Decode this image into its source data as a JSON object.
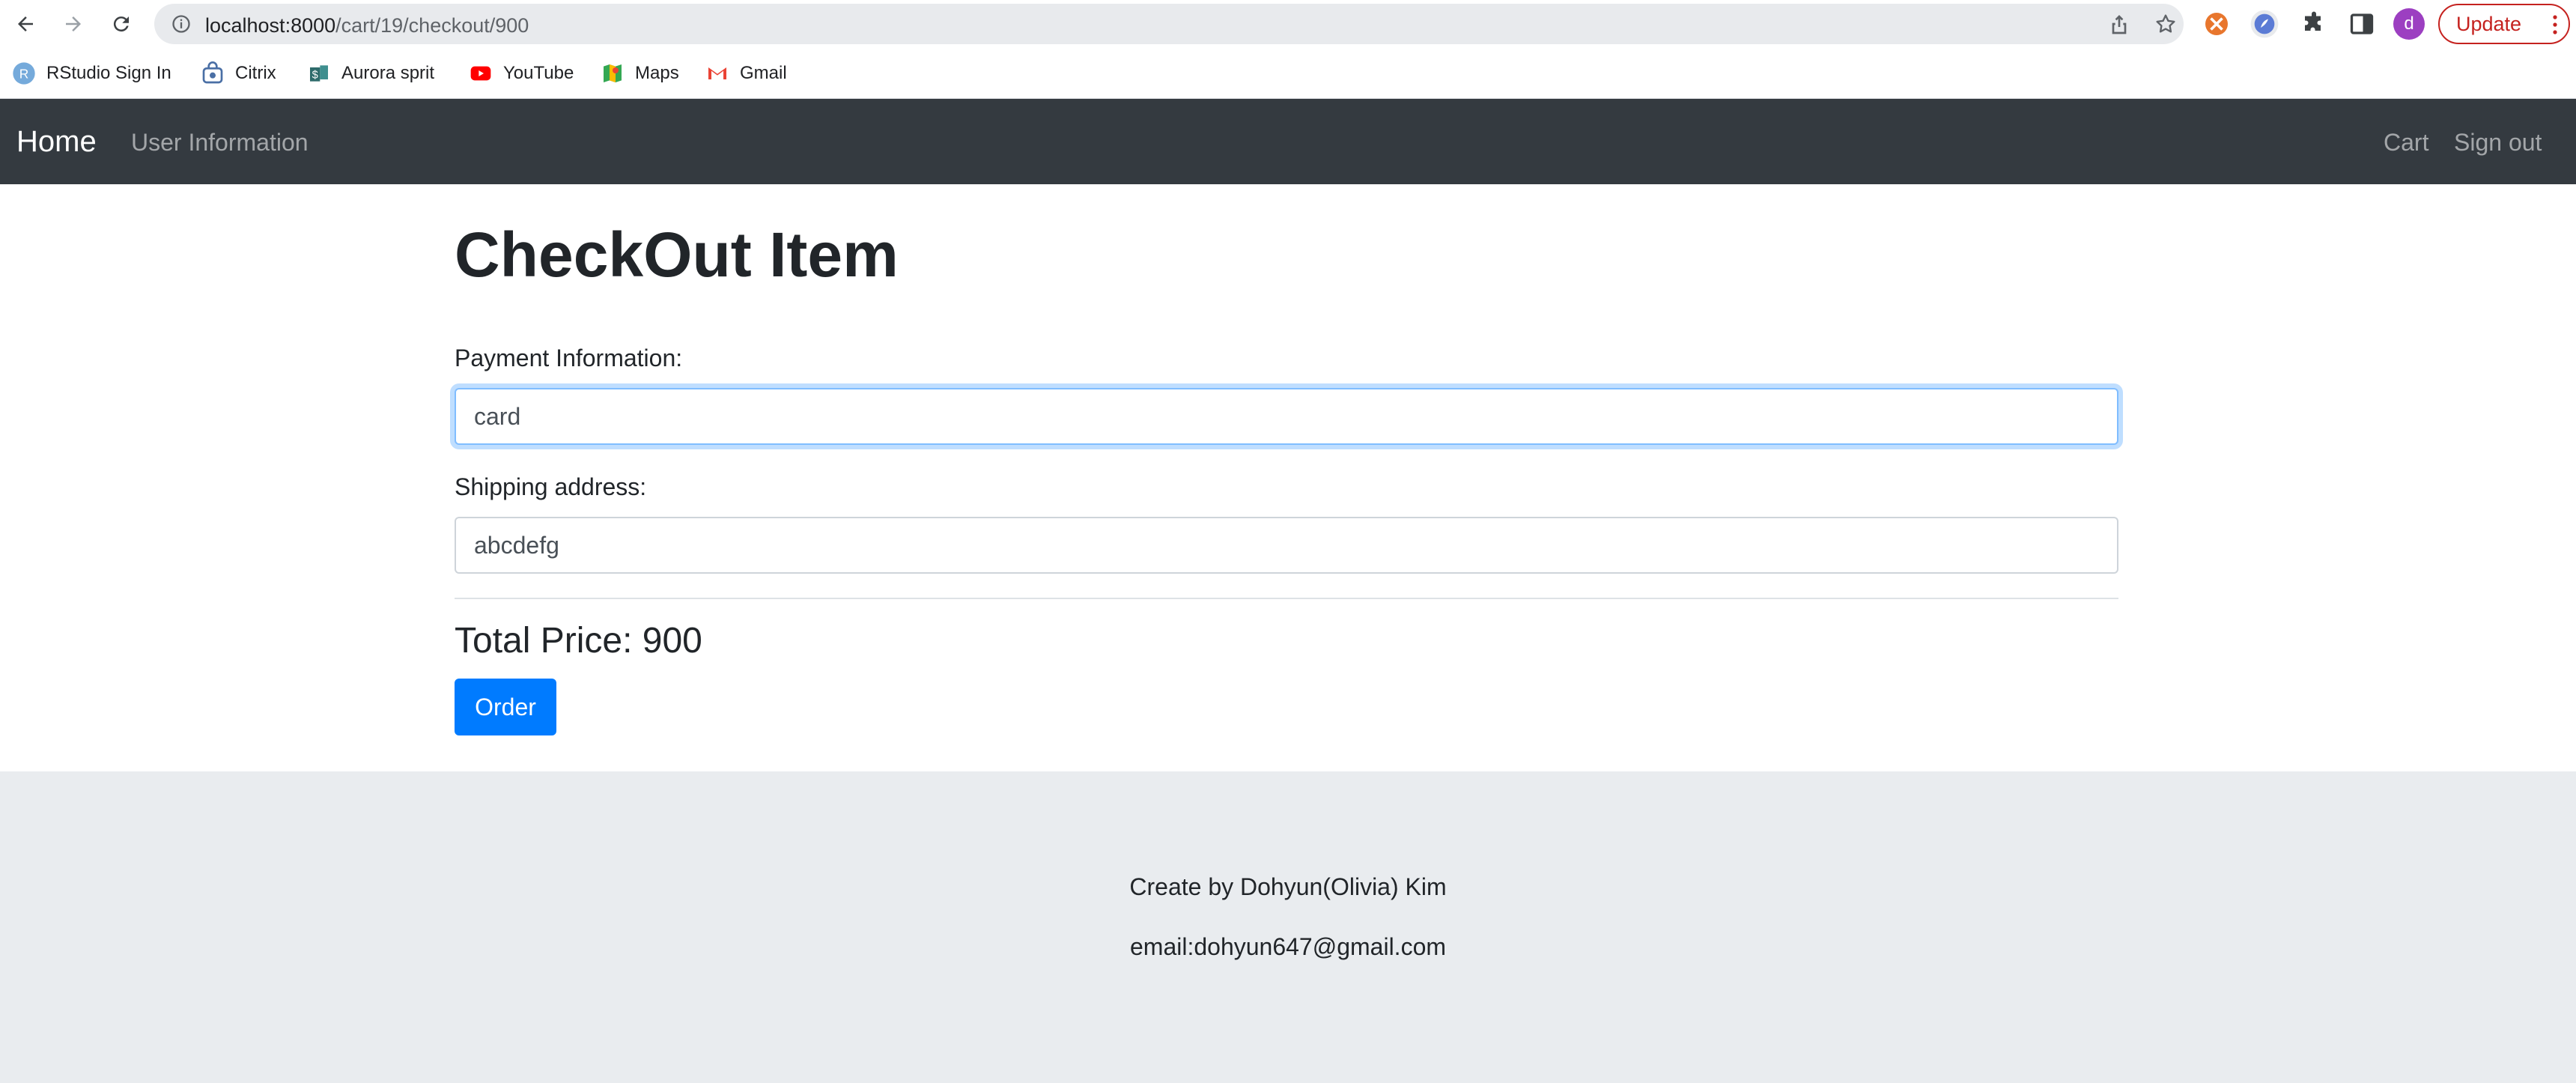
{
  "browser": {
    "url_host": "localhost:8000",
    "url_path": "/cart/19/checkout/900",
    "update_label": "Update",
    "avatar_letter": "d",
    "bookmarks": [
      {
        "label": "RStudio Sign In",
        "icon": "rstudio-icon"
      },
      {
        "label": "Citrix",
        "icon": "citrix-icon"
      },
      {
        "label": "Aurora sprit",
        "icon": "aurora-icon"
      },
      {
        "label": "YouTube",
        "icon": "youtube-icon"
      },
      {
        "label": "Maps",
        "icon": "maps-icon"
      },
      {
        "label": "Gmail",
        "icon": "gmail-icon"
      }
    ]
  },
  "navbar": {
    "brand": "Home",
    "links_left": [
      "User Information"
    ],
    "links_right": [
      "Cart",
      "Sign out"
    ]
  },
  "checkout": {
    "title": "CheckOut Item",
    "payment_label": "Payment Information:",
    "payment_value": "card",
    "shipping_label": "Shipping address:",
    "shipping_value": "abcdefg",
    "total_price": "Total Price: 900",
    "order_label": "Order"
  },
  "footer": {
    "credit": "Create by Dohyun(Olivia) Kim",
    "email": "email:dohyun647@gmail.com"
  },
  "colors": {
    "navbar_bg": "#343a40",
    "primary": "#007bff",
    "footer_bg": "#e9ecef"
  }
}
